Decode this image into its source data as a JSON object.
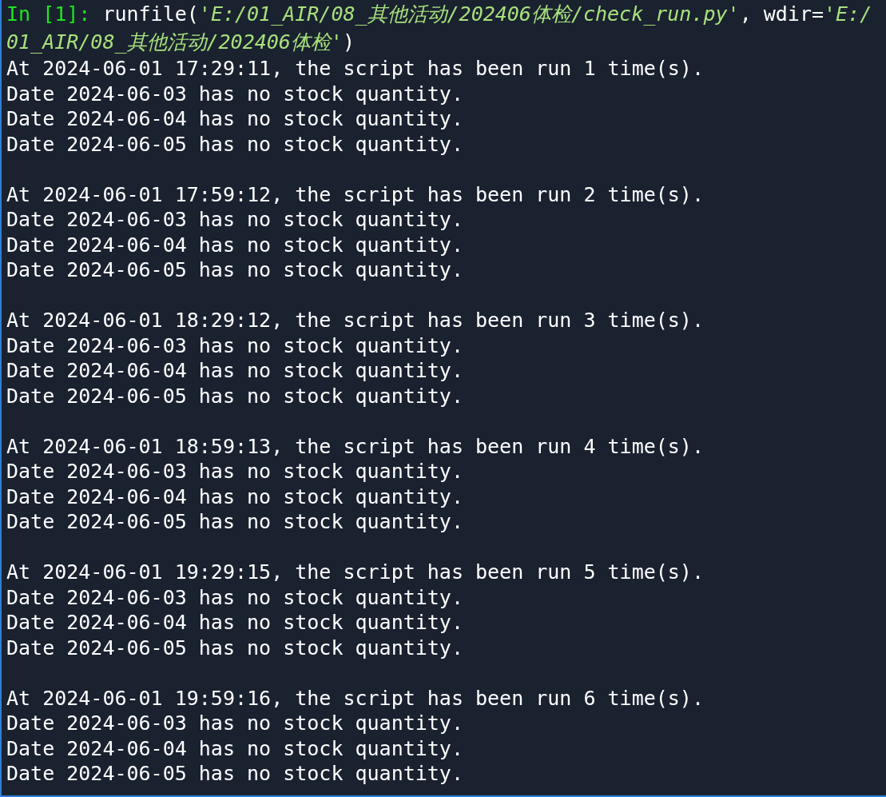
{
  "input": {
    "lines": [
      [
        {
          "kind": "prompt",
          "text": "In [1]:"
        },
        {
          "kind": "plain",
          "text": " runfile("
        },
        {
          "kind": "string",
          "text": "'E:/01_AIR/08_其他活动/202406体检/check_run.py'"
        },
        {
          "kind": "plain",
          "text": ", wdir="
        },
        {
          "kind": "string",
          "text": "'E:/"
        }
      ],
      [
        {
          "kind": "string",
          "text": "01_AIR/08_其他活动/202406体检'"
        },
        {
          "kind": "plain",
          "text": ")"
        }
      ]
    ]
  },
  "output": [
    {
      "lines": [
        "At 2024-06-01 17:29:11, the script has been run 1 time(s).",
        "Date 2024-06-03 has no stock quantity.",
        "Date 2024-06-04 has no stock quantity.",
        "Date 2024-06-05 has no stock quantity."
      ]
    },
    {
      "lines": [
        "At 2024-06-01 17:59:12, the script has been run 2 time(s).",
        "Date 2024-06-03 has no stock quantity.",
        "Date 2024-06-04 has no stock quantity.",
        "Date 2024-06-05 has no stock quantity."
      ]
    },
    {
      "lines": [
        "At 2024-06-01 18:29:12, the script has been run 3 time(s).",
        "Date 2024-06-03 has no stock quantity.",
        "Date 2024-06-04 has no stock quantity.",
        "Date 2024-06-05 has no stock quantity."
      ]
    },
    {
      "lines": [
        "At 2024-06-01 18:59:13, the script has been run 4 time(s).",
        "Date 2024-06-03 has no stock quantity.",
        "Date 2024-06-04 has no stock quantity.",
        "Date 2024-06-05 has no stock quantity."
      ]
    },
    {
      "lines": [
        "At 2024-06-01 19:29:15, the script has been run 5 time(s).",
        "Date 2024-06-03 has no stock quantity.",
        "Date 2024-06-04 has no stock quantity.",
        "Date 2024-06-05 has no stock quantity."
      ]
    },
    {
      "lines": [
        "At 2024-06-01 19:59:16, the script has been run 6 time(s).",
        "Date 2024-06-03 has no stock quantity.",
        "Date 2024-06-04 has no stock quantity.",
        "Date 2024-06-05 has no stock quantity."
      ]
    }
  ]
}
